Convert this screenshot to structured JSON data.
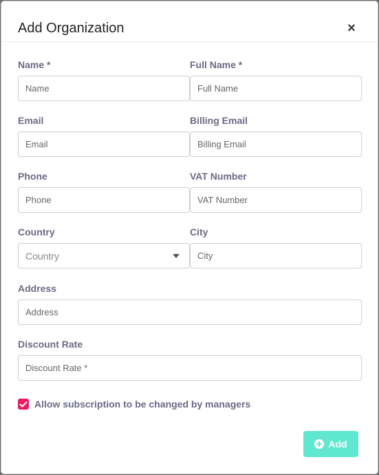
{
  "modal": {
    "title": "Add Organization",
    "close_label": "×"
  },
  "fields": {
    "name": {
      "label": "Name *",
      "placeholder": "Name"
    },
    "full_name": {
      "label": "Full Name *",
      "placeholder": "Full Name"
    },
    "email": {
      "label": "Email",
      "placeholder": "Email"
    },
    "billing_email": {
      "label": "Billing Email",
      "placeholder": "Billing Email"
    },
    "phone": {
      "label": "Phone",
      "placeholder": "Phone"
    },
    "vat_number": {
      "label": "VAT Number",
      "placeholder": "VAT Number"
    },
    "country": {
      "label": "Country",
      "placeholder": "Country"
    },
    "city": {
      "label": "City",
      "placeholder": "City"
    },
    "address": {
      "label": "Address",
      "placeholder": "Address"
    },
    "discount_rate": {
      "label": "Discount Rate",
      "placeholder": "Discount Rate *"
    }
  },
  "checkbox": {
    "label": "Allow subscription to be changed by managers",
    "checked": true
  },
  "actions": {
    "add_label": "Add"
  },
  "colors": {
    "accent": "#5fe8cf",
    "checkbox": "#e91e63",
    "label": "#6a6a86"
  }
}
